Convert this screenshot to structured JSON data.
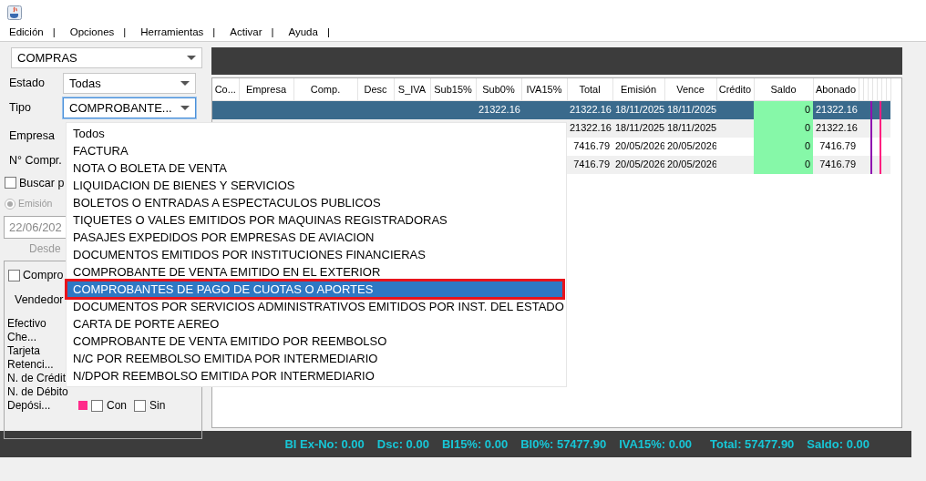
{
  "menu": [
    {
      "label": "Edición",
      "separator": "|"
    },
    {
      "label": "Opciones",
      "separator": "|"
    },
    {
      "label": "Herramientas",
      "separator": "|"
    },
    {
      "label": "Activar",
      "separator": "|"
    },
    {
      "label": "Ayuda",
      "separator": "|"
    }
  ],
  "filters": {
    "module": "COMPRAS",
    "estado_label": "Estado",
    "estado": "Todas",
    "tipo_label": "Tipo",
    "tipo": "COMPROBANTE...",
    "empresa_label": "Empresa",
    "numero_label": "N° Compr.",
    "buscar": {
      "label": "Buscar p",
      "checked": false
    },
    "emision": {
      "label": "Emisión",
      "selected": true,
      "disabled": true
    },
    "date": "22/06/202",
    "desde_label": "Desde",
    "compro": {
      "label": "Compro",
      "checked": false
    },
    "vendedor_label": "Vendedor"
  },
  "payment_methods": [
    "Efectivo",
    "Che...",
    "Tarjeta",
    "Retenci...",
    "N. de Crédit",
    "N. de Débito",
    "Depósi..."
  ],
  "deposit_filter": {
    "color": "#ff2a8a",
    "options": [
      {
        "label": "Con",
        "checked": false
      },
      {
        "label": "Sin",
        "checked": false
      }
    ]
  },
  "table": {
    "columns": [
      "Co...",
      "Empresa",
      "Comp.",
      "Desc",
      "S_IVA",
      "Sub15%",
      "Sub0%",
      "IVA15%",
      "Total",
      "Emisión",
      "Vence",
      "Crédito",
      "Saldo",
      "Abonado"
    ],
    "rows": [
      {
        "selected": true,
        "cells": [
          "",
          "",
          "",
          "",
          "",
          "",
          "21322.16",
          "",
          "21322.16",
          "18/11/2025",
          "18/11/2025",
          "",
          "0",
          "21322.16"
        ],
        "tags": [
          {
            "color": "#8e10b0"
          },
          {
            "color": "#ff1f80"
          }
        ]
      },
      {
        "selected": false,
        "cells": [
          "",
          "",
          "",
          "",
          "",
          "",
          "",
          "",
          "21322.16",
          "18/11/2025",
          "18/11/2025",
          "",
          "0",
          "21322.16"
        ],
        "tags": [
          {
            "color": "#8e10b0"
          },
          {
            "color": "#ff1f80"
          }
        ]
      },
      {
        "selected": false,
        "cells": [
          "",
          "",
          "",
          "",
          "",
          "",
          "",
          "",
          "7416.79",
          "20/05/2026",
          "20/05/2026",
          "",
          "0",
          "7416.79"
        ],
        "tags": [
          {
            "color": "#8e10b0"
          },
          {
            "color": "#ff1f80"
          }
        ]
      },
      {
        "selected": false,
        "cells": [
          "",
          "",
          "",
          "",
          "",
          "",
          "",
          "",
          "7416.79",
          "20/05/2026",
          "20/05/2026",
          "",
          "0",
          "7416.79"
        ],
        "tags": [
          {
            "color": "#8e10b0"
          },
          {
            "color": "#ff1f80"
          }
        ]
      }
    ]
  },
  "tipo_dropdown": {
    "items": [
      {
        "label": "Todos",
        "selected": false
      },
      {
        "label": "FACTURA",
        "selected": false
      },
      {
        "label": "NOTA O BOLETA DE VENTA",
        "selected": false
      },
      {
        "label": "LIQUIDACION DE BIENES Y SERVICIOS",
        "selected": false
      },
      {
        "label": "BOLETOS O ENTRADAS A ESPECTACULOS PUBLICOS",
        "selected": false
      },
      {
        "label": "TIQUETES O VALES EMITIDOS POR MAQUINAS REGISTRADORAS",
        "selected": false
      },
      {
        "label": "PASAJES EXPEDIDOS POR EMPRESAS DE AVIACION",
        "selected": false
      },
      {
        "label": "DOCUMENTOS EMITIDOS POR INSTITUCIONES FINANCIERAS",
        "selected": false
      },
      {
        "label": "COMPROBANTE DE VENTA EMITIDO EN EL EXTERIOR",
        "selected": false
      },
      {
        "label": "COMPROBANTES DE PAGO DE CUOTAS O APORTES",
        "selected": true
      },
      {
        "label": "DOCUMENTOS POR SERVICIOS ADMINISTRATIVOS EMITIDOS POR INST. DEL ESTADO",
        "selected": false
      },
      {
        "label": "CARTA DE PORTE AEREO",
        "selected": false
      },
      {
        "label": "COMPROBANTE DE VENTA EMITIDO POR REEMBOLSO",
        "selected": false
      },
      {
        "label": "N/C POR REEMBOLSO EMITIDA POR INTERMEDIARIO",
        "selected": false
      },
      {
        "label": "N/DPOR REEMBOLSO EMITIDA POR INTERMEDIARIO",
        "selected": false
      }
    ]
  },
  "totals": [
    "BI Ex-No: 0.00",
    "Dsc: 0.00",
    "BI15%: 0.00",
    "BI0%: 57477.90",
    "IVA15%: 0.00",
    "Total: 57477.90",
    "Saldo: 0.00"
  ]
}
